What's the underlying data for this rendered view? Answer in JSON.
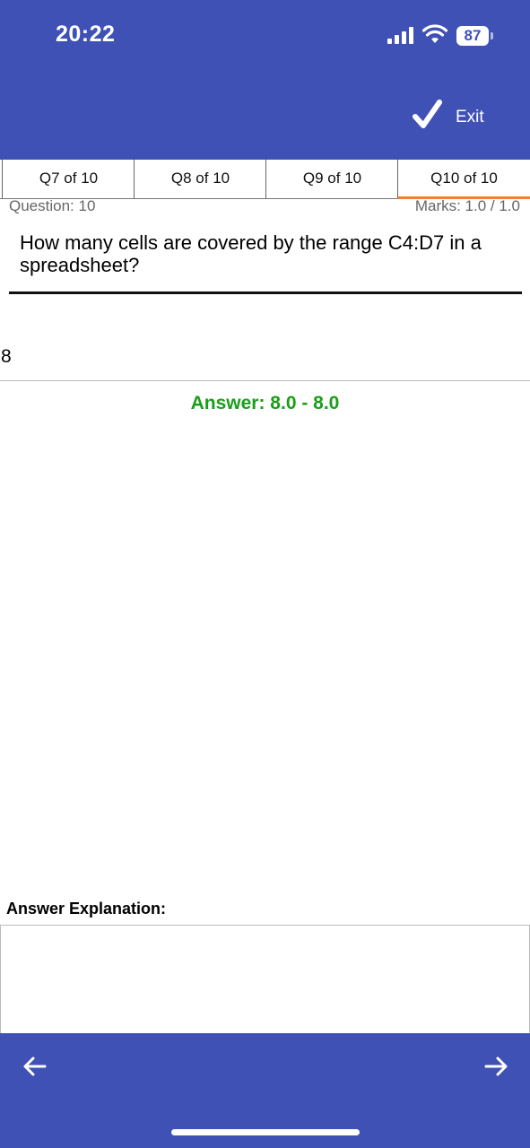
{
  "status_bar": {
    "time": "20:22",
    "battery": "87"
  },
  "header": {
    "exit_label": "Exit",
    "exit_icon": "checkmark-icon"
  },
  "tabs": [
    {
      "label": "Q7 of 10",
      "active": false
    },
    {
      "label": "Q8 of 10",
      "active": false
    },
    {
      "label": "Q9 of 10",
      "active": false
    },
    {
      "label": "Q10 of 10",
      "active": true
    }
  ],
  "question": {
    "number_label": "Question: 10",
    "marks_label": "Marks: 1.0 / 1.0",
    "text": "How many cells are covered by the range C4:D7 in a spreadsheet?"
  },
  "answer": {
    "input_value": "8",
    "correct_answer": "Answer: 8.0 - 8.0"
  },
  "explanation": {
    "label": "Answer Explanation:",
    "text": ""
  },
  "footer": {
    "prev_icon": "arrow-left-icon",
    "next_icon": "arrow-right-icon"
  },
  "colors": {
    "primary": "#3f51b5",
    "accent": "#f08030",
    "correct": "#1a9e1a"
  }
}
